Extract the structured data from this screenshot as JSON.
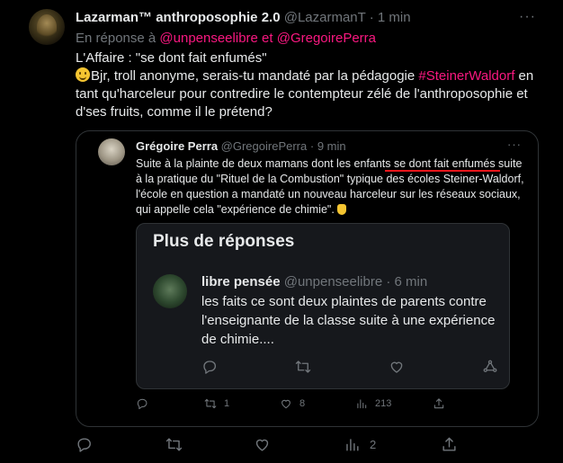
{
  "tweet": {
    "author_name": "Lazarman™ anthroposophie 2.0",
    "author_handle": "@LazarmanT",
    "time": "1 min",
    "reply_prefix": "En réponse à",
    "reply_to_1": "@unpenseelibre",
    "reply_join": "et",
    "reply_to_2": "@GregoirePerra",
    "line1": "L'Affaire : \"se dont fait enfumés\"",
    "line2_before": "Bjr, troll anonyme, serais-tu mandaté par la pédagogie ",
    "hashtag": "#SteinerWaldorf",
    "line2_after": " en tant qu'harceleur pour contredire le contempteur zélé de l'anthroposophie et d'ses fruits, comme il le prétend?",
    "reply_count": "",
    "retweet_count": "",
    "like_count": "",
    "views_count": "2"
  },
  "quote": {
    "author_name": "Grégoire Perra",
    "author_handle": "@GregoirePerra",
    "time": "9 min",
    "text_a": "Suite à la plainte de deux mamans dont les enfants ",
    "text_highlight": "se dont fait enfumés",
    "text_b": " suite à la pratique du \"Rituel de la Combustion\" typique des écoles Steiner-Waldorf,  l'école en question a mandaté un nouveau harceleur sur les réseaux sociaux, qui appelle cela \"expérience de chimie\".",
    "reply_count": "",
    "retweet_count": "1",
    "like_count": "8",
    "views_count": "213"
  },
  "more_replies": {
    "title": "Plus de réponses",
    "author_name": "libre pensée",
    "author_handle": "@unpenseelibre",
    "time": "6 min",
    "text": "les faits ce sont deux plaintes de parents contre l'enseignante de la classe suite à une expérience de chimie...."
  },
  "colors": {
    "accent": "#f91880",
    "underline": "#e8161b",
    "muted": "#71767b",
    "text": "#e7e9ea",
    "background": "#000000",
    "panel": "#16181c"
  },
  "icons": [
    "reply-icon",
    "retweet-icon",
    "like-icon",
    "views-icon",
    "share-icon",
    "more-icon"
  ]
}
